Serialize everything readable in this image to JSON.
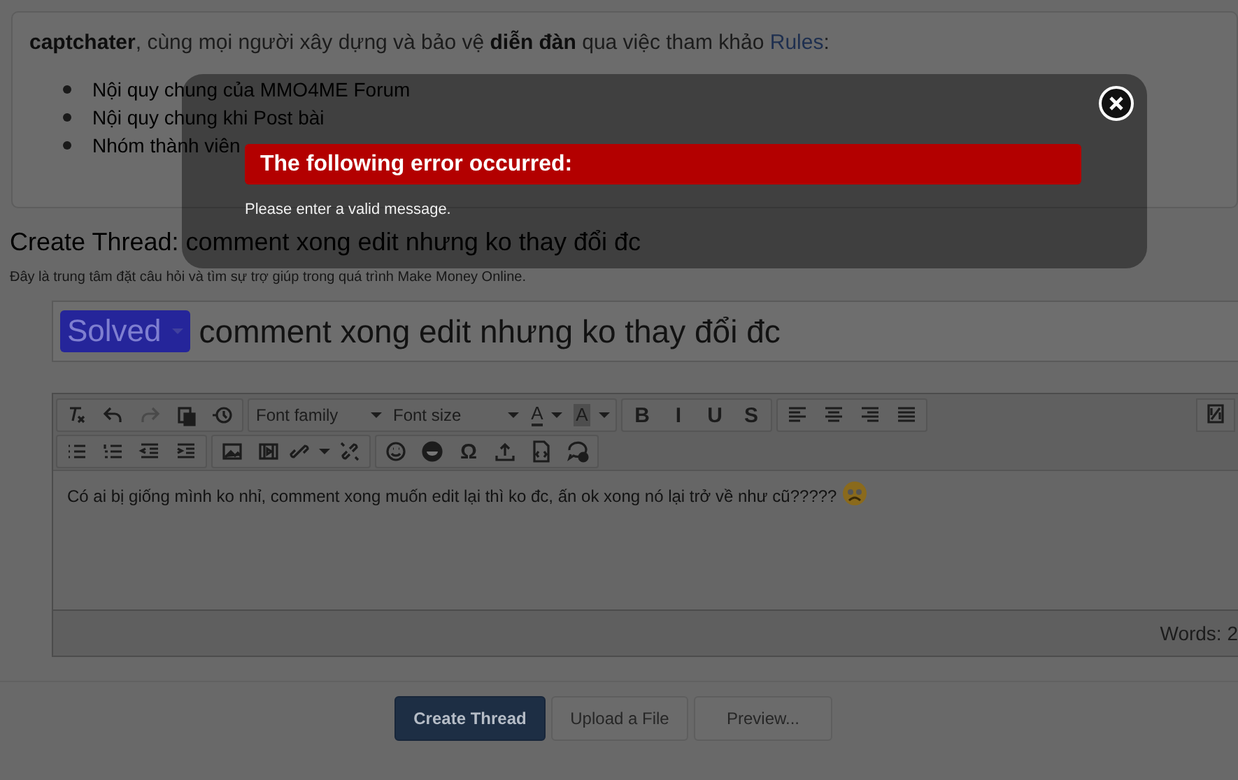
{
  "notice": {
    "text": "**captchater**, cùng mọi người xây dựng và bảo vệ **diễn đàn** qua việc tham khảo",
    "link": "Rules",
    "after": ":",
    "items": [
      "Nội quy chung của MMO4ME Forum",
      "Nội quy chung khi Post bài",
      "Nhóm thành viên"
    ]
  },
  "page": {
    "title": "Create Thread: comment xong edit nhưng ko thay đổi đc",
    "subtitle": "Đây là trung tâm đặt câu hỏi và tìm sự trợ giúp trong quá trình Make Money Online."
  },
  "thread_title": {
    "prefix": "Solved",
    "value": "comment xong edit nhưng ko thay đổi đc"
  },
  "toolbar": {
    "row_1": [
      [
        {
          "kind": "icon"
        },
        {
          "kind": "icon"
        },
        {
          "kind": "icon"
        },
        {
          "kind": "icon"
        },
        {
          "kind": "icon"
        }
      ],
      [
        {
          "kind": "dropdown",
          "label": "Font family"
        },
        {
          "kind": "dropdown",
          "label": "Font size"
        },
        {
          "kind": "color",
          "label": "A"
        },
        {
          "kind": "highlight",
          "label": "A"
        }
      ],
      [
        {
          "kind": "glyph",
          "label": "B"
        },
        {
          "kind": "glyph",
          "label": "I"
        },
        {
          "kind": "glyph",
          "label": "U"
        },
        {
          "kind": "glyph",
          "label": "S"
        }
      ],
      [
        {
          "kind": "icon"
        },
        {
          "kind": "icon"
        },
        {
          "kind": "icon"
        },
        {
          "kind": "icon"
        }
      ]
    ],
    "row_2": [
      [
        {
          "kind": "icon"
        },
        {
          "kind": "icon"
        },
        {
          "kind": "icon"
        },
        {
          "kind": "icon"
        }
      ],
      [
        {
          "kind": "icon"
        },
        {
          "kind": "icon"
        },
        {
          "kind": "split"
        },
        {
          "kind": "icon"
        }
      ],
      [
        {
          "kind": "icon"
        },
        {
          "kind": "icon"
        },
        {
          "kind": "glyph",
          "label": "Ω"
        },
        {
          "kind": "icon"
        },
        {
          "kind": "icon"
        },
        {
          "kind": "icon"
        }
      ]
    ]
  },
  "editor": {
    "content": "Có ai bị giống mình ko nhỉ, comment xong muốn edit lại thì ko đc, ấn ok xong nó lại trở về như cũ?????",
    "word_count": "Words: 2"
  },
  "buttons": [
    {
      "label": "Create Thread",
      "primary": true
    },
    {
      "label": "Upload a File",
      "primary": false
    },
    {
      "label": "Preview...",
      "primary": false
    }
  ],
  "modal": {
    "heading": "The following error occurred:",
    "message": "Please enter a valid message."
  }
}
